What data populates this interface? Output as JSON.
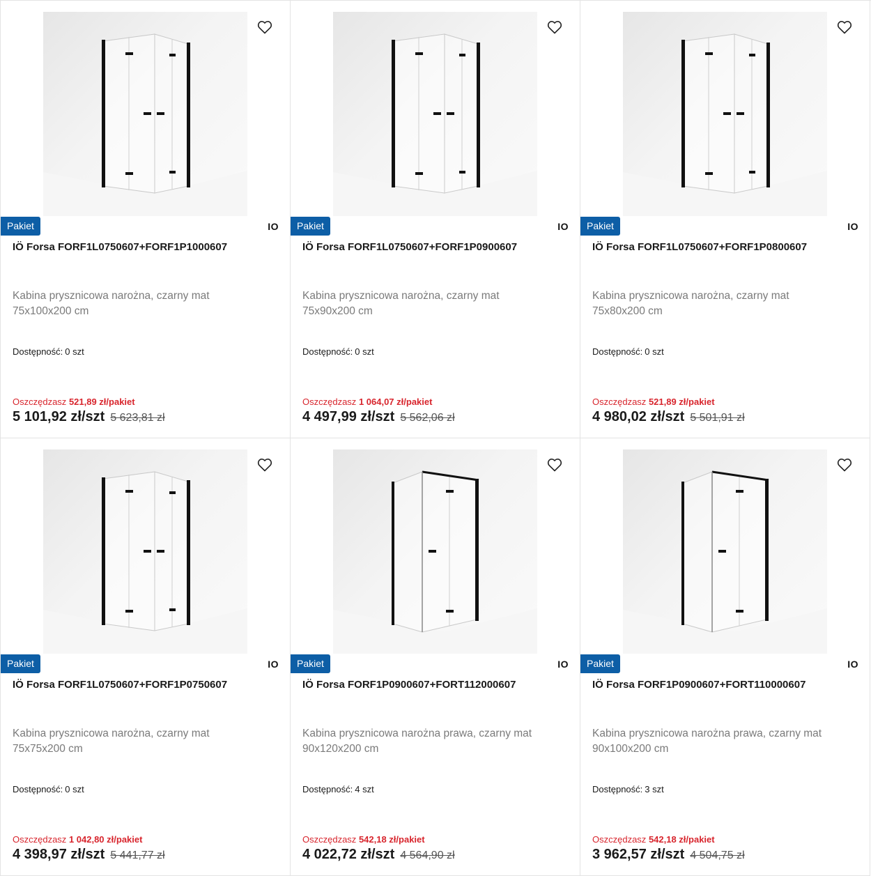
{
  "colors": {
    "badge": "#0d5ea6",
    "savings": "#d8252d",
    "frame": "#111111"
  },
  "icons": {
    "favorite": "heart-outline-icon"
  },
  "products": [
    {
      "badge": "Pakiet",
      "brand": "IO",
      "title": "IÖ Forsa FORF1L0750607+FORF1P1000607",
      "description": "Kabina prysznicowa narożna, czarny mat 75x100x200 cm",
      "availability_label": "Dostępność:",
      "availability_value": "0 szt",
      "savings_label": "Oszczędzasz",
      "savings_amount": "521,89 zł/pakiet",
      "price": "5 101,92 zł/szt",
      "old_price": "5 623,81 zł",
      "image": "corner-bifold"
    },
    {
      "badge": "Pakiet",
      "brand": "IO",
      "title": "IÖ Forsa FORF1L0750607+FORF1P0900607",
      "description": "Kabina prysznicowa narożna, czarny mat 75x90x200 cm",
      "availability_label": "Dostępność:",
      "availability_value": "0 szt",
      "savings_label": "Oszczędzasz",
      "savings_amount": "1 064,07 zł/pakiet",
      "price": "4 497,99 zł/szt",
      "old_price": "5 562,06 zł",
      "image": "corner-bifold"
    },
    {
      "badge": "Pakiet",
      "brand": "IO",
      "title": "IÖ Forsa FORF1L0750607+FORF1P0800607",
      "description": "Kabina prysznicowa narożna, czarny mat 75x80x200 cm",
      "availability_label": "Dostępność:",
      "availability_value": "0 szt",
      "savings_label": "Oszczędzasz",
      "savings_amount": "521,89 zł/pakiet",
      "price": "4 980,02 zł/szt",
      "old_price": "5 501,91 zł",
      "image": "corner-bifold"
    },
    {
      "badge": "Pakiet",
      "brand": "IO",
      "title": "IÖ Forsa FORF1L0750607+FORF1P0750607",
      "description": "Kabina prysznicowa narożna, czarny mat 75x75x200 cm",
      "availability_label": "Dostępność:",
      "availability_value": "0 szt",
      "savings_label": "Oszczędzasz",
      "savings_amount": "1 042,80 zł/pakiet",
      "price": "4 398,97 zł/szt",
      "old_price": "5 441,77 zł",
      "image": "corner-bifold"
    },
    {
      "badge": "Pakiet",
      "brand": "IO",
      "title": "IÖ Forsa FORF1P0900607+FORT112000607",
      "description": "Kabina prysznicowa narożna prawa, czarny mat 90x120x200 cm",
      "availability_label": "Dostępność:",
      "availability_value": "4 szt",
      "savings_label": "Oszczędzasz",
      "savings_amount": "542,18 zł/pakiet",
      "price": "4 022,72 zł/szt",
      "old_price": "4 564,90 zł",
      "image": "corner-fixed"
    },
    {
      "badge": "Pakiet",
      "brand": "IO",
      "title": "IÖ Forsa FORF1P0900607+FORT110000607",
      "description": "Kabina prysznicowa narożna prawa, czarny mat 90x100x200 cm",
      "availability_label": "Dostępność:",
      "availability_value": "3 szt",
      "savings_label": "Oszczędzasz",
      "savings_amount": "542,18 zł/pakiet",
      "price": "3 962,57 zł/szt",
      "old_price": "4 504,75 zł",
      "image": "corner-fixed"
    }
  ]
}
